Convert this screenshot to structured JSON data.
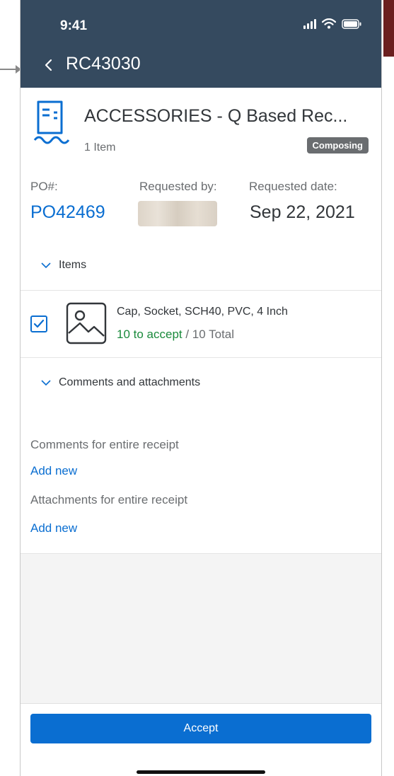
{
  "status_bar": {
    "time": "9:41"
  },
  "header": {
    "title": "RC43030"
  },
  "receipt": {
    "title": "ACCESSORIES - Q Based Rec...",
    "item_count": "1 Item",
    "status": "Composing"
  },
  "details": {
    "po_label": "PO#:",
    "po_value": "PO42469",
    "requested_by_label": "Requested by:",
    "requested_date_label": "Requested date:",
    "requested_date_value": "Sep 22, 2021"
  },
  "items_section": {
    "label": "Items",
    "items": [
      {
        "name": "Cap, Socket, SCH40, PVC, 4 Inch",
        "to_accept": "10 to accept",
        "total": " / 10 Total",
        "checked": true
      }
    ]
  },
  "comments_section": {
    "label": "Comments and attachments",
    "comments_label": "Comments for entire receipt",
    "comments_add": "Add new",
    "attachments_label": "Attachments for entire receipt",
    "attachments_add": "Add new"
  },
  "footer": {
    "accept_label": "Accept"
  },
  "colors": {
    "header_bg": "#354a5f",
    "link_blue": "#0a6ed1",
    "accept_green": "#1a8a3c",
    "badge_grey": "#6a6d70"
  }
}
